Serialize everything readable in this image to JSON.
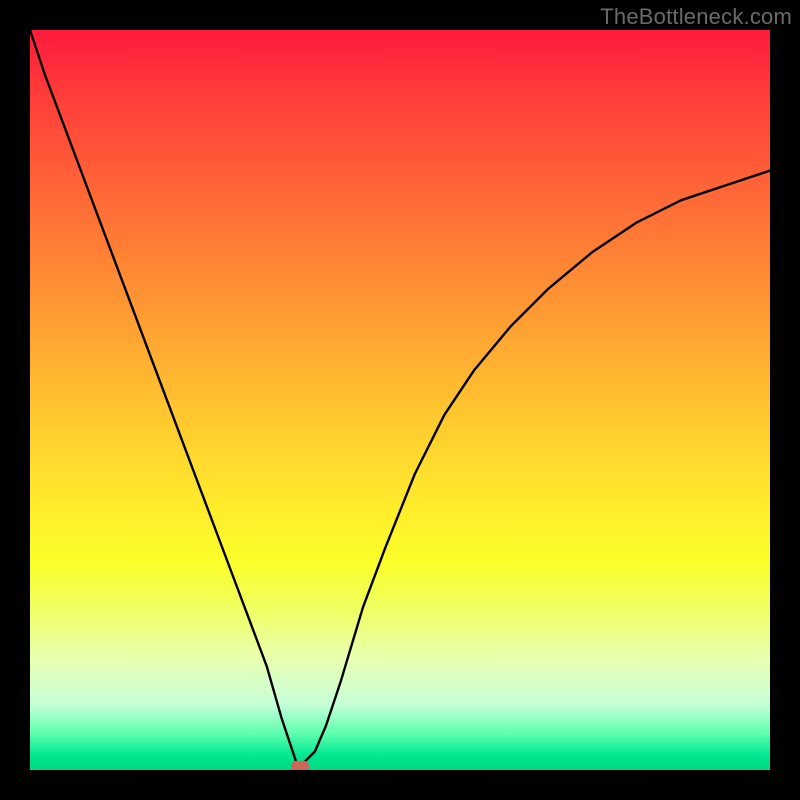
{
  "watermark": "TheBottleneck.com",
  "chart_data": {
    "type": "line",
    "title": "",
    "xlabel": "",
    "ylabel": "",
    "xlim": [
      0,
      100
    ],
    "ylim": [
      0,
      100
    ],
    "series": [
      {
        "name": "bottleneck-curve",
        "x": [
          0,
          2,
          5,
          8,
          11,
          14,
          17,
          20,
          23,
          26,
          29,
          32,
          34,
          35.5,
          36,
          36.5,
          37,
          38.5,
          40,
          42,
          45,
          48,
          52,
          56,
          60,
          65,
          70,
          76,
          82,
          88,
          94,
          100
        ],
        "y": [
          100,
          94,
          86,
          78,
          70,
          62,
          54,
          46,
          38,
          30,
          22,
          14,
          7,
          2.5,
          1,
          0.5,
          1,
          2.5,
          6,
          12,
          22,
          30,
          40,
          48,
          54,
          60,
          65,
          70,
          74,
          77,
          79,
          81
        ]
      }
    ],
    "marker": {
      "x": 36.5,
      "y": 0.5,
      "color": "#cc6655"
    },
    "background_gradient": {
      "top": "#ff1a3c",
      "mid": "#ffda2e",
      "bottom": "#00d880"
    }
  }
}
